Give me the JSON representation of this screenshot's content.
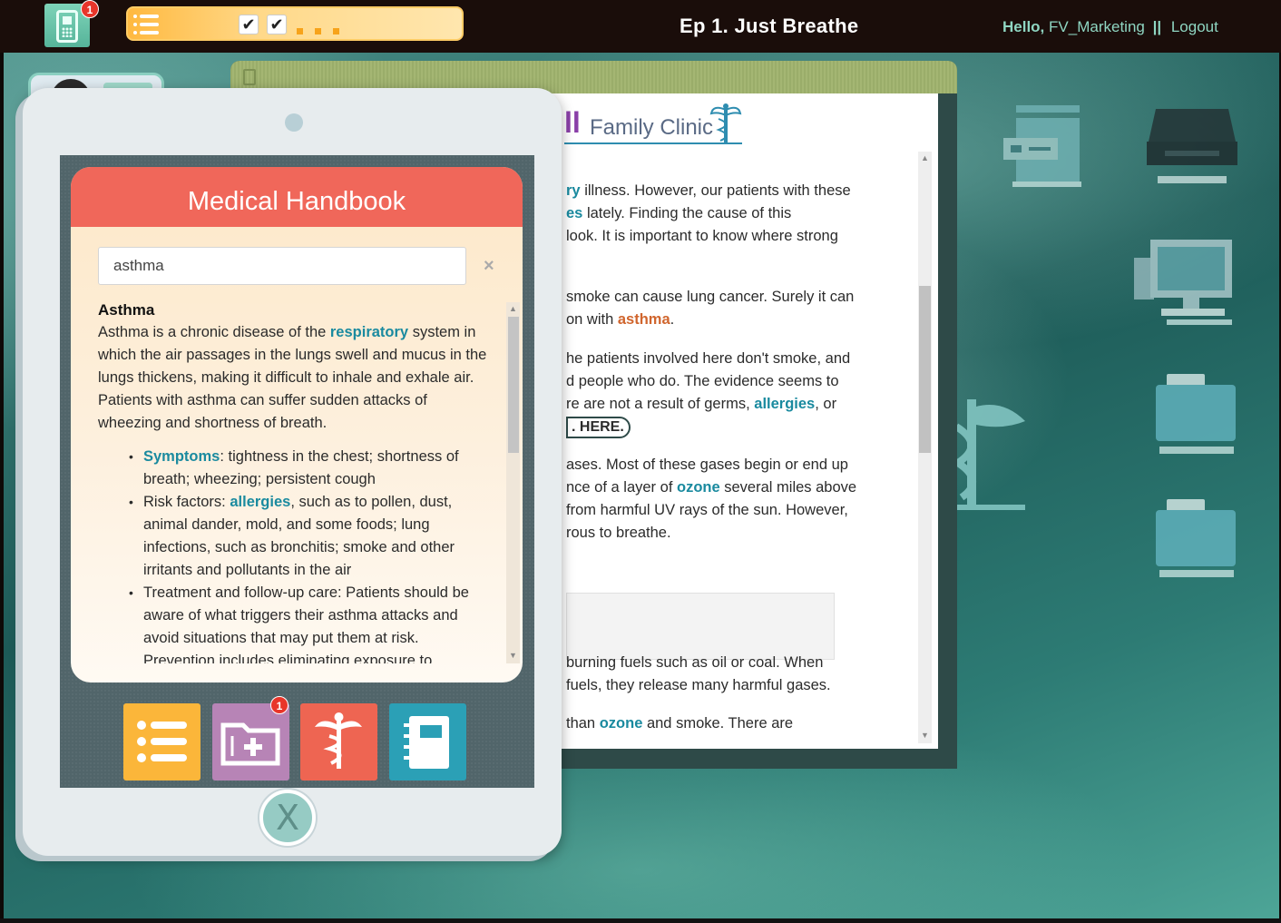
{
  "topbar": {
    "phone_badge": "1",
    "episode_title": "Ep 1. Just Breathe",
    "hello_label": "Hello,",
    "username": "FV_Marketing",
    "separator": "||",
    "logout_label": "Logout",
    "progress": {
      "check_1": "✔",
      "check_2": "✔"
    }
  },
  "document": {
    "logo_ll": "ll",
    "logo_name": "Family Clinic",
    "lines": {
      "l1_kw": "ry",
      "l1_rest": " illness. However, our patients with these",
      "l2_kw": "es",
      "l2_rest": " lately. Finding the cause of this",
      "l3": "look. It is important to know where strong",
      "l4": "smoke can cause lung cancer. Surely it can",
      "l5_pre": "on with ",
      "l5_kw": "asthma",
      "l5_post": ".",
      "l6": "he patients involved here don't smoke, and",
      "l7": "d people who do. The evidence seems to",
      "l8_pre": "re are not a result of germs, ",
      "l8_kw": "allergies",
      "l8_post": ", or",
      "here_btn": ". HERE.",
      "l9": "ases. Most of these gases begin or end up",
      "l10_pre": "nce of a layer of ",
      "l10_kw": "ozone",
      "l10_post": " several miles above",
      "l11": " from harmful UV rays of the sun. However,",
      "l12": "rous to breathe.",
      "l13": " burning fuels such as oil or coal. When",
      "l14": " fuels, they release many harmful gases.",
      "l15_pre": " than ",
      "l15_kw": "ozone",
      "l15_post": " and smoke. There are"
    }
  },
  "handbook": {
    "title": "Medical Handbook",
    "search_value": "asthma",
    "clear_label": "×",
    "entry_title": "Asthma",
    "intro_pre": "Asthma is a chronic disease of the ",
    "intro_kw": "respiratory",
    "intro_post": " system in which the air passages in the lungs swell and mucus in the lungs thickens, making it difficult to inhale and exhale air. Patients with asthma can suffer sudden attacks of wheezing and shortness of breath.",
    "bullets": {
      "b1_kw": "Symptoms",
      "b1_rest": ": tightness in the chest; shortness of breath; wheezing; persistent cough",
      "b2_pre": "Risk factors: ",
      "b2_kw": "allergies",
      "b2_rest": ", such as to pollen, dust, animal dander, mold, and some foods; lung infections, such as bronchitis; smoke and other irritants and pollutants in the air",
      "b3": "Treatment and follow-up care: Patients should be aware of what triggers their asthma attacks and avoid situations that may put them at risk. Prevention includes eliminating exposure to"
    }
  },
  "apps": {
    "folder_badge": "1"
  },
  "tablet": {
    "close_label": "X"
  },
  "colors": {
    "accent_teal": "#1a8a9f",
    "accent_orange": "#d0652d",
    "handbook_header": "#f0675a"
  }
}
